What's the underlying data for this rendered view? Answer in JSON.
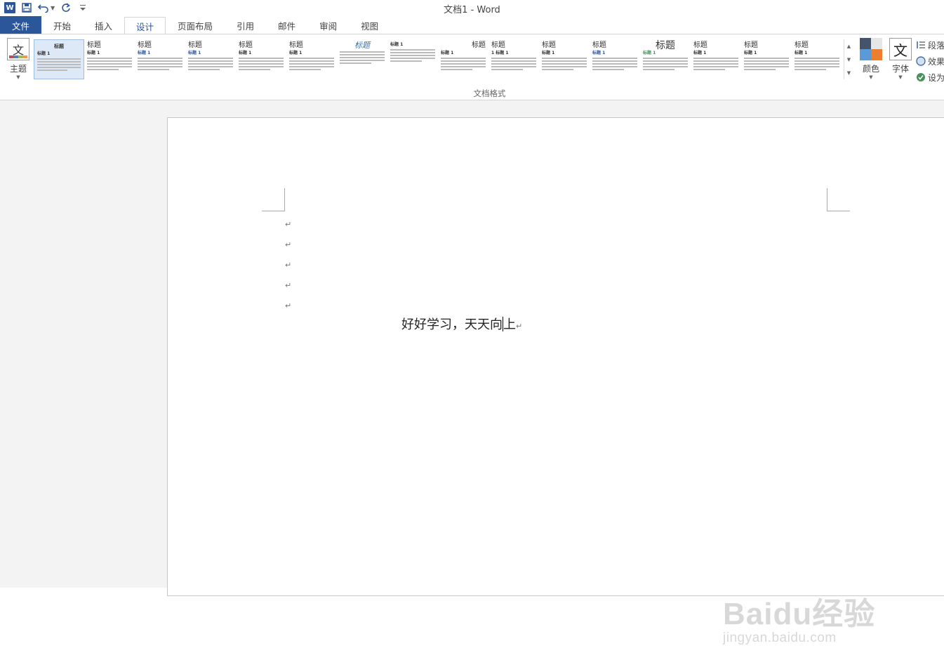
{
  "window": {
    "title": "文档1 - Word",
    "app_icon_text": "W"
  },
  "qat": {
    "icons": [
      "save-icon",
      "undo-icon",
      "redo-icon",
      "customize-icon"
    ]
  },
  "tabs": [
    {
      "label": "文件",
      "type": "file"
    },
    {
      "label": "开始"
    },
    {
      "label": "插入"
    },
    {
      "label": "设计",
      "active": true
    },
    {
      "label": "页面布局"
    },
    {
      "label": "引用"
    },
    {
      "label": "邮件"
    },
    {
      "label": "审阅"
    },
    {
      "label": "视图"
    }
  ],
  "ribbon": {
    "theme": {
      "label": "主题",
      "icon_text": "文"
    },
    "gallery": {
      "items": [
        {
          "title": "标题",
          "h1": "标题 1"
        },
        {
          "title": "标题",
          "h1": "标题 1"
        },
        {
          "title": "标题",
          "h1": "标题 1"
        },
        {
          "title": "标题",
          "h1": "标题 1"
        },
        {
          "title": "标题",
          "h1": "标题 1"
        },
        {
          "title": "标题",
          "h1": "标题 1"
        },
        {
          "title": "标题",
          "h1": ""
        },
        {
          "title": "",
          "h1": "标题 1"
        },
        {
          "title": "标题",
          "h1": "标题 1"
        },
        {
          "title": "标题",
          "h1": "1 标题 1"
        },
        {
          "title": "标题",
          "h1": "标题 1"
        },
        {
          "title": "标题",
          "h1": "标题 1"
        },
        {
          "title": "标题",
          "h1": "标题 1"
        },
        {
          "title": "标题",
          "h1": "标题 1"
        },
        {
          "title": "标题",
          "h1": "标题 1"
        },
        {
          "title": "标题",
          "h1": "标题 1"
        }
      ]
    },
    "colors": {
      "label": "颜色",
      "swatch": [
        "#44546a",
        "#e7e6e6",
        "#5b9bd5",
        "#ed7d31"
      ]
    },
    "fonts": {
      "label": "字体",
      "icon_text": "文"
    },
    "side": [
      {
        "label": "段落",
        "icon": "paragraph-spacing-icon"
      },
      {
        "label": "效果",
        "icon": "effects-icon"
      },
      {
        "label": "设为",
        "icon": "set-default-icon"
      }
    ],
    "group_label": "文档格式"
  },
  "document": {
    "paragraph_mark": "↵",
    "empty_lines": 5,
    "text": "好好学习，天天向上"
  },
  "watermark": {
    "logo": "Baidu经验",
    "url": "jingyan.baidu.com"
  }
}
